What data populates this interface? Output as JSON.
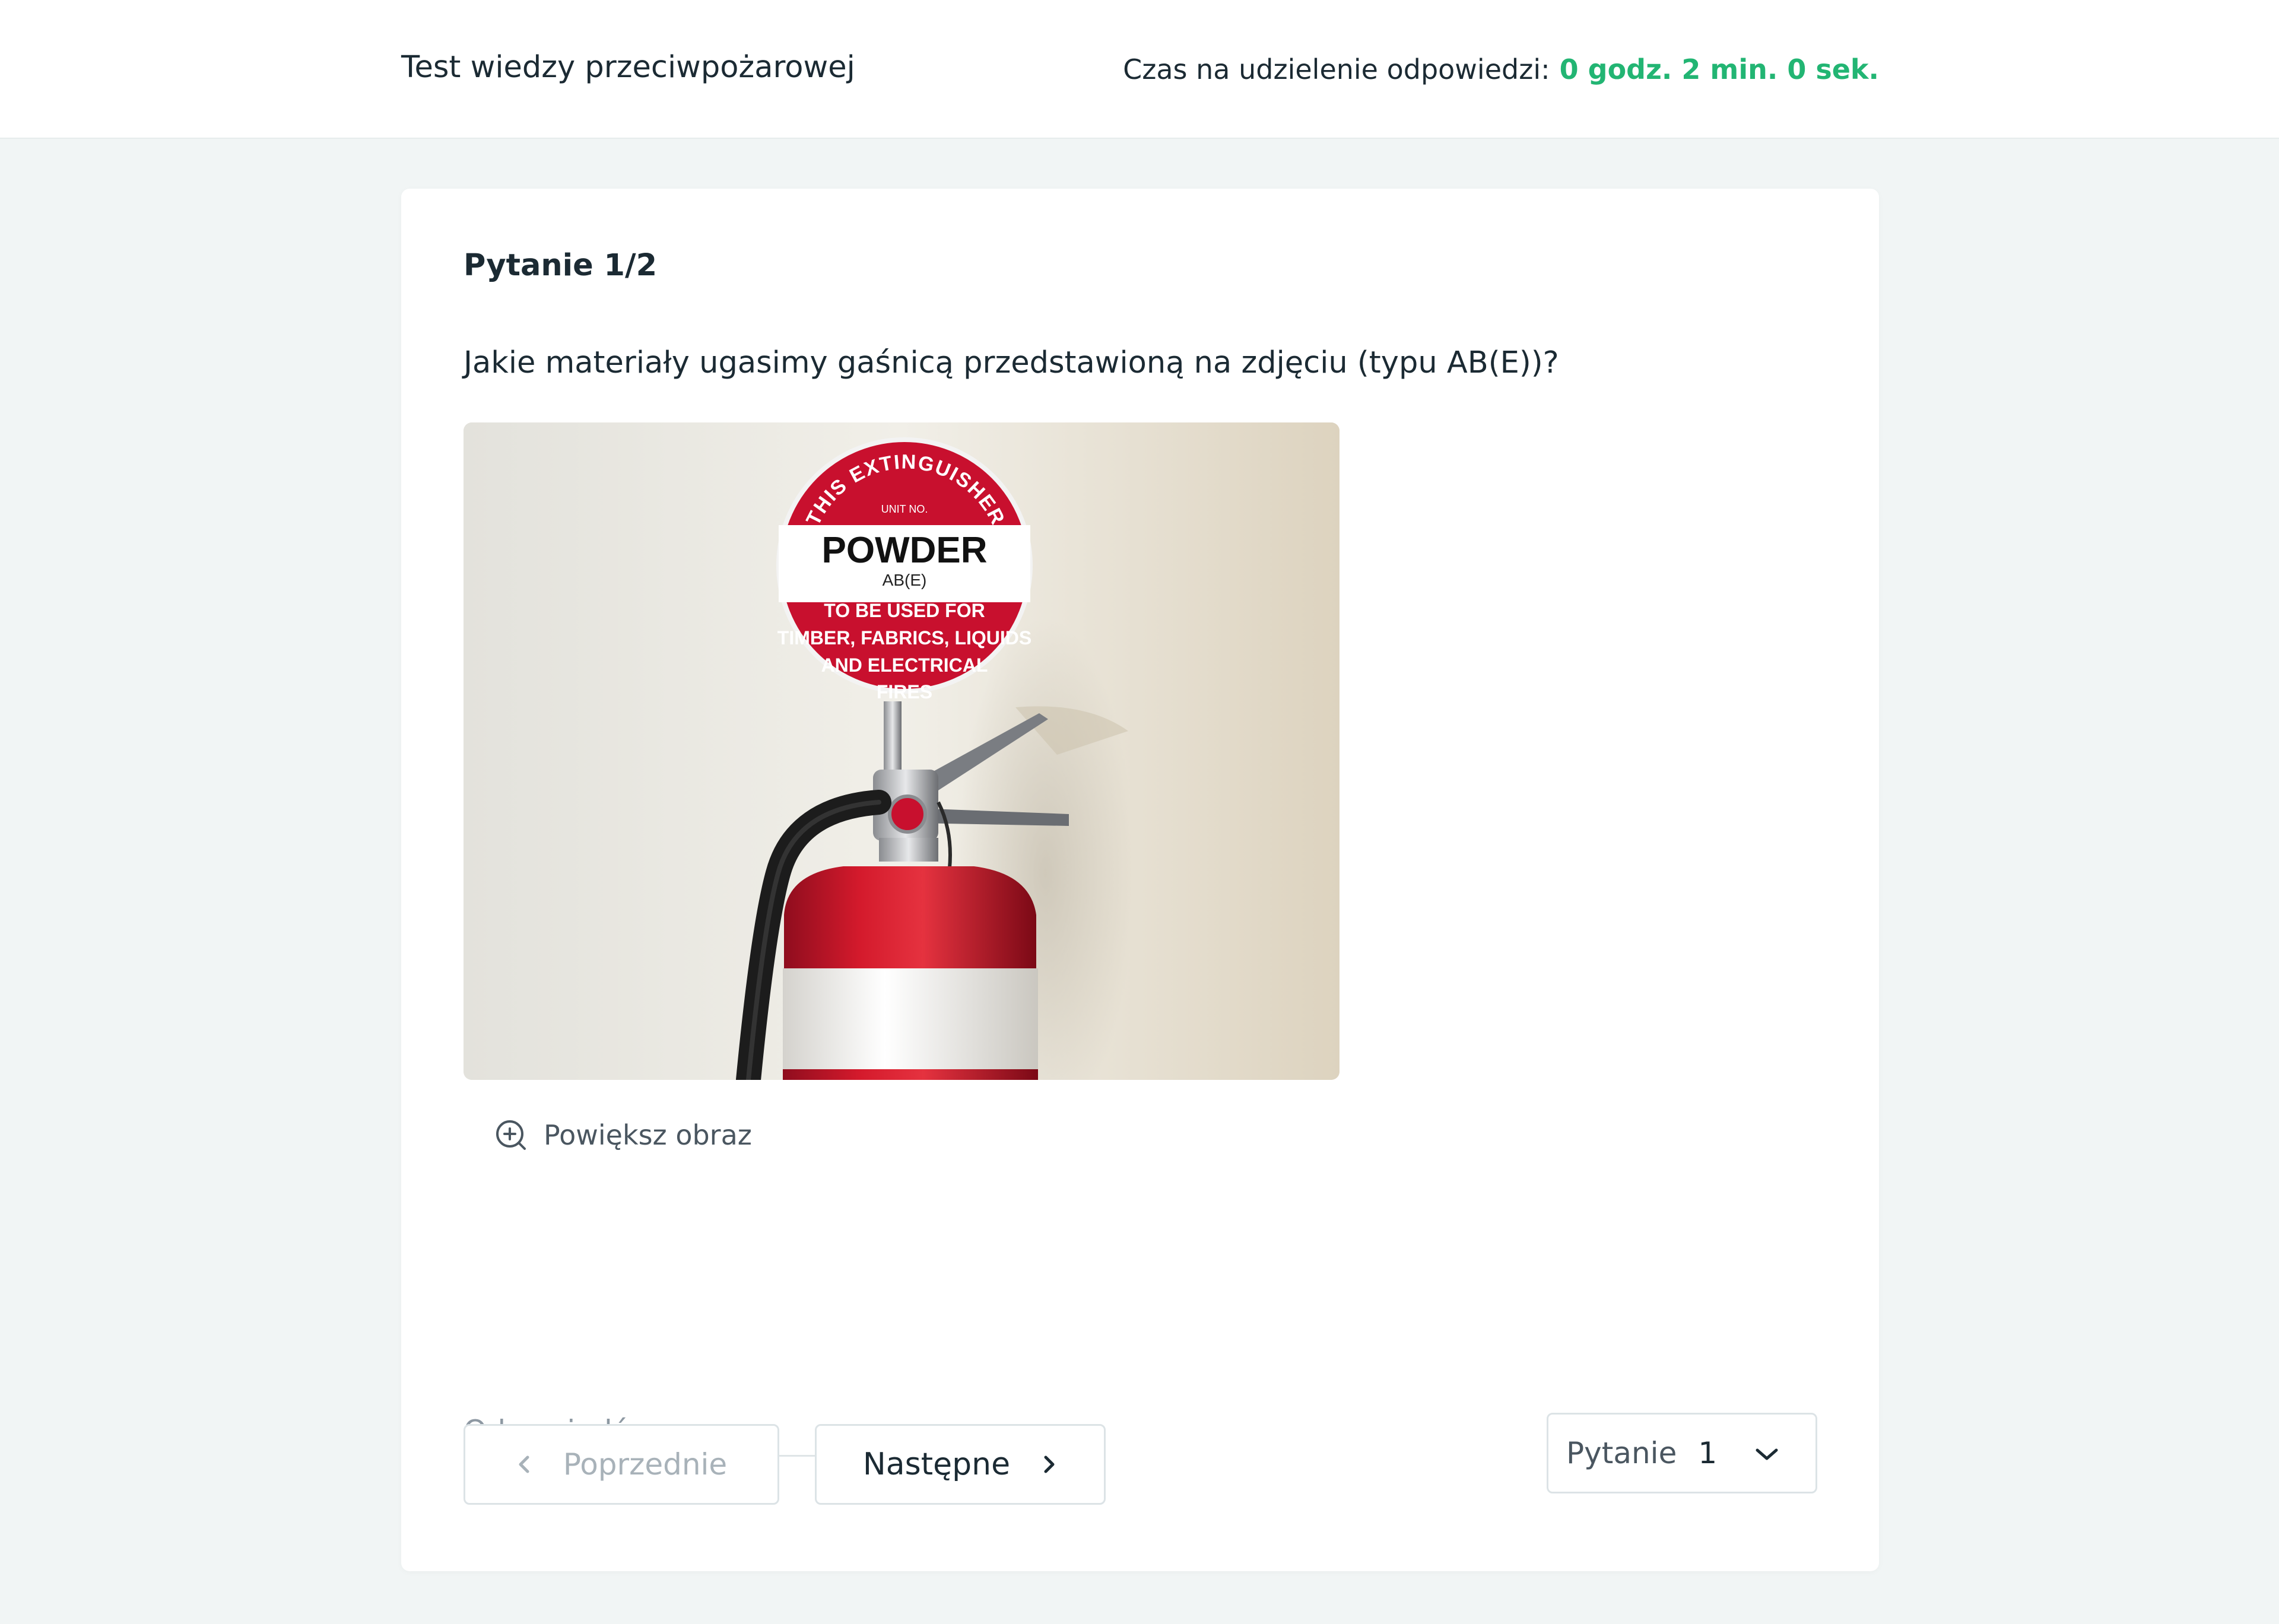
{
  "header": {
    "title": "Test wiedzy przeciwpożarowej",
    "timer_label": "Czas na udzielenie odpowiedzi:",
    "timer_value": "0 godz. 2 min. 0 sek.",
    "timer_color": "#22b573"
  },
  "question": {
    "counter": "Pytanie 1/2",
    "text": "Jakie materiały ugasimy gaśnicą przedstawioną na zdjęciu (typu AB(E))?",
    "image": {
      "sign_line1": "THIS EXTINGUISHER",
      "sign_line2": "UNIT NO.",
      "sign_type": "POWDER",
      "sign_class": "AB(E)",
      "sign_use_lines": [
        "TO BE USED FOR",
        "TIMBER, FABRICS, LIQUIDS",
        "AND ELECTRICAL",
        "FIRES"
      ]
    },
    "zoom_label": "Powiększ obraz",
    "zoom_icon": "zoom-in-icon"
  },
  "answer": {
    "placeholder": "Odpowiedź",
    "value": ""
  },
  "navigation": {
    "prev_label": "Poprzednie",
    "next_label": "Następne",
    "prev_icon": "chevron-left-icon",
    "next_icon": "chevron-right-icon",
    "select_label": "Pytanie",
    "select_value": "1",
    "select_icon": "chevron-down-icon"
  },
  "colors": {
    "accent": "#22b573",
    "extinguisher_red": "#c8102e",
    "background": "#f1f5f5"
  }
}
